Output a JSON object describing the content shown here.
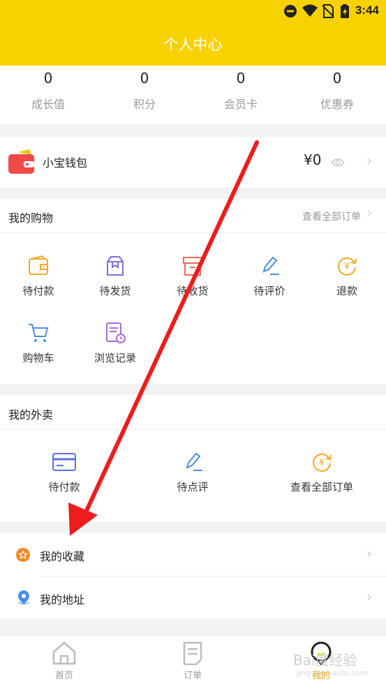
{
  "status_bar": {
    "time": "3:44"
  },
  "header": {
    "title": "个人中心"
  },
  "stats": [
    {
      "value": "0",
      "label": "成长值"
    },
    {
      "value": "0",
      "label": "积分"
    },
    {
      "value": "0",
      "label": "会员卡"
    },
    {
      "value": "0",
      "label": "优惠券"
    }
  ],
  "wallet": {
    "name": "小宝钱包",
    "amount": "¥0"
  },
  "shopping": {
    "title": "我的购物",
    "view_all": "查看全部订单",
    "items": [
      {
        "label": "待付款",
        "icon": "wallet-icon"
      },
      {
        "label": "待发货",
        "icon": "package-icon"
      },
      {
        "label": "待收货",
        "icon": "box-icon"
      },
      {
        "label": "待评价",
        "icon": "pen-icon"
      },
      {
        "label": "退款",
        "icon": "refund-icon"
      },
      {
        "label": "购物车",
        "icon": "cart-icon"
      },
      {
        "label": "浏览记录",
        "icon": "history-icon"
      }
    ]
  },
  "takeout": {
    "title": "我的外卖",
    "items": [
      {
        "label": "待付款",
        "icon": "card-icon"
      },
      {
        "label": "待点评",
        "icon": "pen-icon"
      },
      {
        "label": "查看全部订单",
        "icon": "refund-icon"
      }
    ]
  },
  "menu": [
    {
      "label": "我的收藏",
      "icon": "star-badge-icon"
    },
    {
      "label": "我的地址",
      "icon": "location-pin-icon"
    }
  ],
  "tabbar": [
    {
      "label": "首页",
      "icon": "home-icon"
    },
    {
      "label": "订单",
      "icon": "order-icon"
    },
    {
      "label": "我的",
      "icon": "profile-icon"
    }
  ],
  "watermark": {
    "text": "Bai度经验",
    "sub": "jingyan.baidu.com"
  },
  "colors": {
    "brand": "#f8d200",
    "accent_orange": "#f5a623",
    "arrow": "#ee1c1c"
  }
}
